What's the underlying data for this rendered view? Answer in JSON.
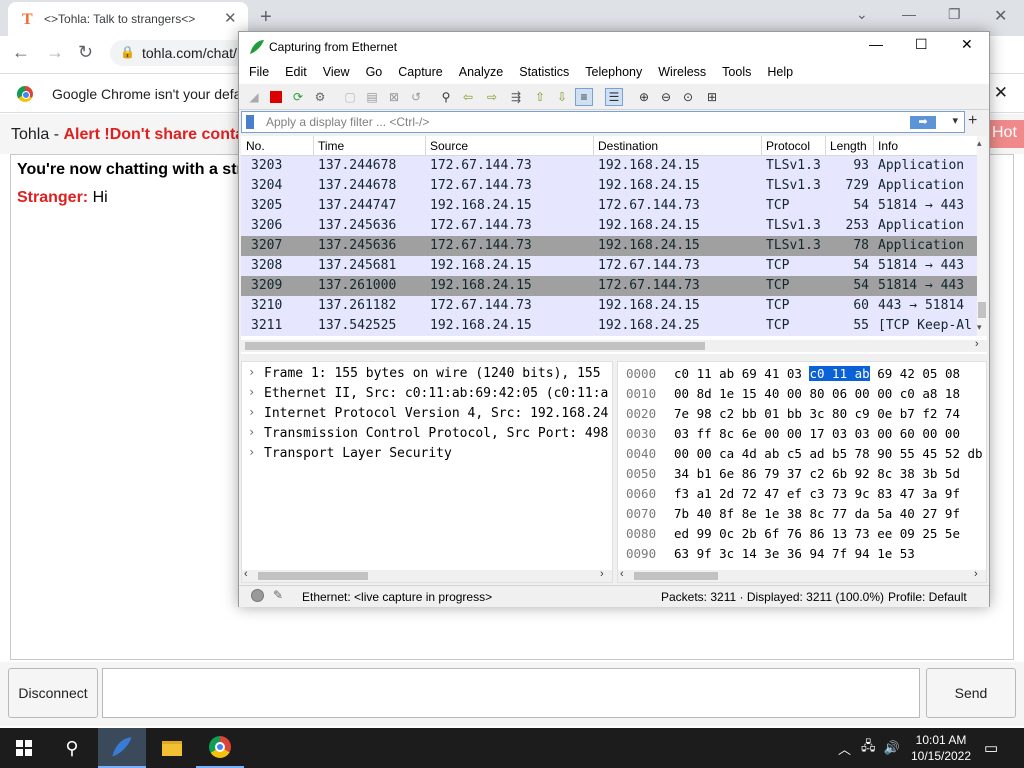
{
  "browser": {
    "tab_title": "<>Tohla: Talk to strangers<>",
    "tab_favicon": "T",
    "url": "tohla.com/chat/",
    "infobar_text": "Google Chrome isn't your default browser"
  },
  "page": {
    "brand": "Tohla",
    "brand_sep": " - ",
    "alert": "Alert !Don't share contact",
    "hot": "Hot",
    "chat_intro": "You're now chatting with a stranger.",
    "stranger_label": "Stranger:",
    "stranger_msg": "Hi",
    "disconnect": "Disconnect",
    "send": "Send"
  },
  "wireshark": {
    "title": "Capturing from Ethernet",
    "menu": [
      "File",
      "Edit",
      "View",
      "Go",
      "Capture",
      "Analyze",
      "Statistics",
      "Telephony",
      "Wireless",
      "Tools",
      "Help"
    ],
    "filter_placeholder": "Apply a display filter ... <Ctrl-/>",
    "columns": [
      "No.",
      "Time",
      "Source",
      "Destination",
      "Protocol",
      "Length",
      "Info"
    ],
    "packets": [
      {
        "no": "3203",
        "time": "137.244678",
        "src": "172.67.144.73",
        "dst": "192.168.24.15",
        "proto": "TLSv1.3",
        "len": "93",
        "info": "Application",
        "bg": "#e7e6ff"
      },
      {
        "no": "3204",
        "time": "137.244678",
        "src": "172.67.144.73",
        "dst": "192.168.24.15",
        "proto": "TLSv1.3",
        "len": "729",
        "info": "Application",
        "bg": "#e7e6ff"
      },
      {
        "no": "3205",
        "time": "137.244747",
        "src": "192.168.24.15",
        "dst": "172.67.144.73",
        "proto": "TCP",
        "len": "54",
        "info": "51814 → 443",
        "bg": "#e7e6ff"
      },
      {
        "no": "3206",
        "time": "137.245636",
        "src": "172.67.144.73",
        "dst": "192.168.24.15",
        "proto": "TLSv1.3",
        "len": "253",
        "info": "Application",
        "bg": "#e7e6ff"
      },
      {
        "no": "3207",
        "time": "137.245636",
        "src": "172.67.144.73",
        "dst": "192.168.24.15",
        "proto": "TLSv1.3",
        "len": "78",
        "info": "Application",
        "bg": "#a0a0a0"
      },
      {
        "no": "3208",
        "time": "137.245681",
        "src": "192.168.24.15",
        "dst": "172.67.144.73",
        "proto": "TCP",
        "len": "54",
        "info": "51814 → 443",
        "bg": "#e7e6ff"
      },
      {
        "no": "3209",
        "time": "137.261000",
        "src": "192.168.24.15",
        "dst": "172.67.144.73",
        "proto": "TCP",
        "len": "54",
        "info": "51814 → 443",
        "bg": "#a0a0a0"
      },
      {
        "no": "3210",
        "time": "137.261182",
        "src": "172.67.144.73",
        "dst": "192.168.24.15",
        "proto": "TCP",
        "len": "60",
        "info": "443 → 51814",
        "bg": "#e7e6ff"
      },
      {
        "no": "3211",
        "time": "137.542525",
        "src": "192.168.24.15",
        "dst": "192.168.24.25",
        "proto": "TCP",
        "len": "55",
        "info": "[TCP Keep-Al",
        "bg": "#e7e6ff"
      }
    ],
    "details": [
      "Frame 1: 155 bytes on wire (1240 bits), 155",
      "Ethernet II, Src: c0:11:ab:69:42:05 (c0:11:a",
      "Internet Protocol Version 4, Src: 192.168.24",
      "Transmission Control Protocol, Src Port: 498",
      "Transport Layer Security"
    ],
    "bytes": [
      {
        "off": "0000",
        "pre": "c0 11 ab 69 41 03 ",
        "hl": "c0 11  ab",
        "post": " 69 42 05 08"
      },
      {
        "off": "0010",
        "pre": "00 8d 1e 15 40 00 80 06  00 00 c0 a8 18",
        "hl": "",
        "post": ""
      },
      {
        "off": "0020",
        "pre": "7e 98 c2 bb 01 bb 3c 80  c9 0e b7 f2 74",
        "hl": "",
        "post": ""
      },
      {
        "off": "0030",
        "pre": "03 ff 8c 6e 00 00 17 03  03 00 60 00 00",
        "hl": "",
        "post": ""
      },
      {
        "off": "0040",
        "pre": "00 00 ca 4d ab c5 ad b5 78  90 55 45 52 db",
        "hl": "",
        "post": ""
      },
      {
        "off": "0050",
        "pre": "34 b1 6e 86 79 37 c2 6b  92 8c 38 3b 5d",
        "hl": "",
        "post": ""
      },
      {
        "off": "0060",
        "pre": "f3 a1 2d 72 47 ef c3 73  9c 83 47 3a 9f",
        "hl": "",
        "post": ""
      },
      {
        "off": "0070",
        "pre": "7b 40 8f 8e 1e 38 8c 77  da 5a 40 27 9f",
        "hl": "",
        "post": ""
      },
      {
        "off": "0080",
        "pre": "ed 99 0c 2b 6f 76 86 13  73 ee 09 25 5e",
        "hl": "",
        "post": ""
      },
      {
        "off": "0090",
        "pre": "63 9f 3c 14 3e 36 94 7f  94 1e 53",
        "hl": "",
        "post": ""
      }
    ],
    "status_iface": "Ethernet: <live capture in progress>",
    "status_packets": "Packets: 3211 · Displayed: 3211 (100.0%)",
    "status_profile": "Profile: Default"
  },
  "taskbar": {
    "time": "10:01 AM",
    "date": "10/15/2022"
  }
}
